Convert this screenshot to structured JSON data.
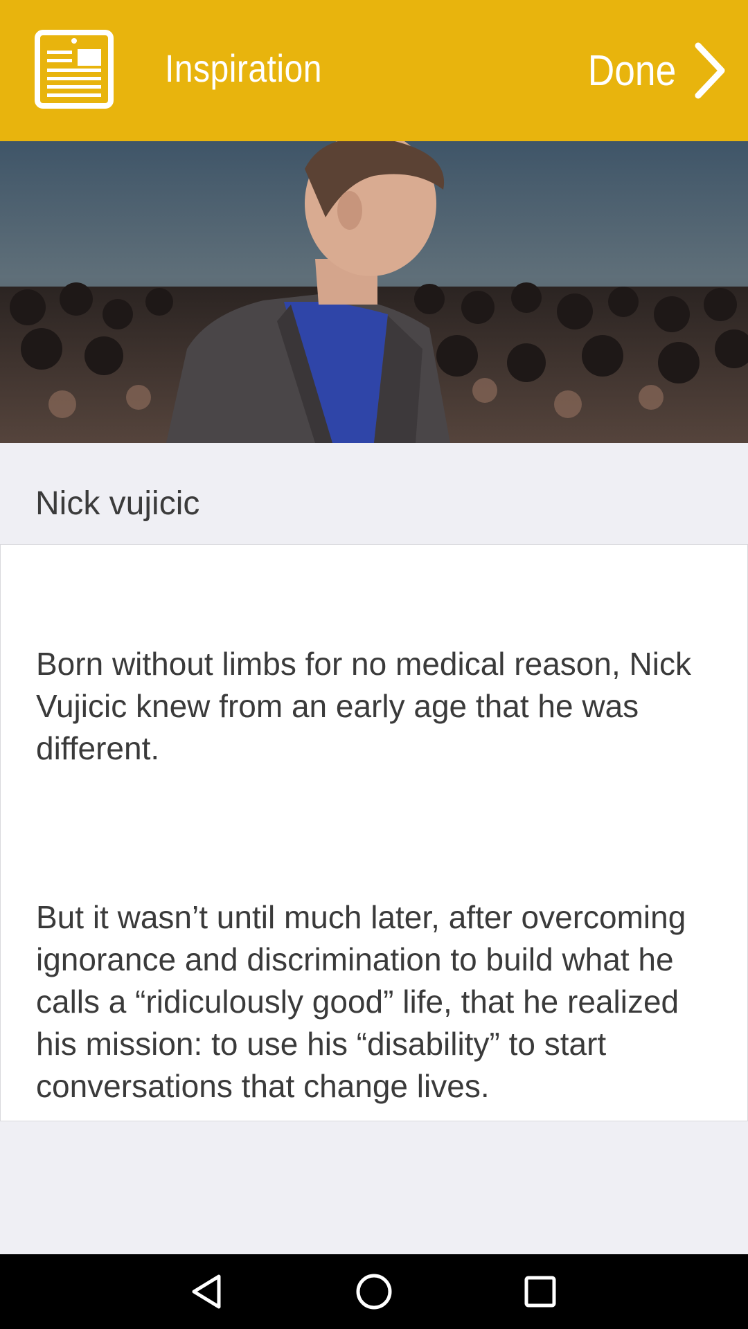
{
  "header": {
    "title": "Inspiration",
    "done_label": "Done",
    "icon": "news-article-icon",
    "back_icon": "chevron-right-icon",
    "color": "#e8b40d"
  },
  "hero": {
    "image": "person-photo"
  },
  "article": {
    "name": "Nick vujicic",
    "paragraphs": [
      "Born without limbs for no medical reason, Nick Vujicic knew from an early age that he was different.",
      "But it wasn’t until much later, after overcoming ignorance and discrimination to build what he calls a “ridiculously good” life, that he realized his mission: to use his “disability” to start conversations that change lives."
    ]
  },
  "nav": {
    "back_icon": "back-triangle-icon",
    "home_icon": "home-circle-icon",
    "recents_icon": "recents-square-icon"
  }
}
